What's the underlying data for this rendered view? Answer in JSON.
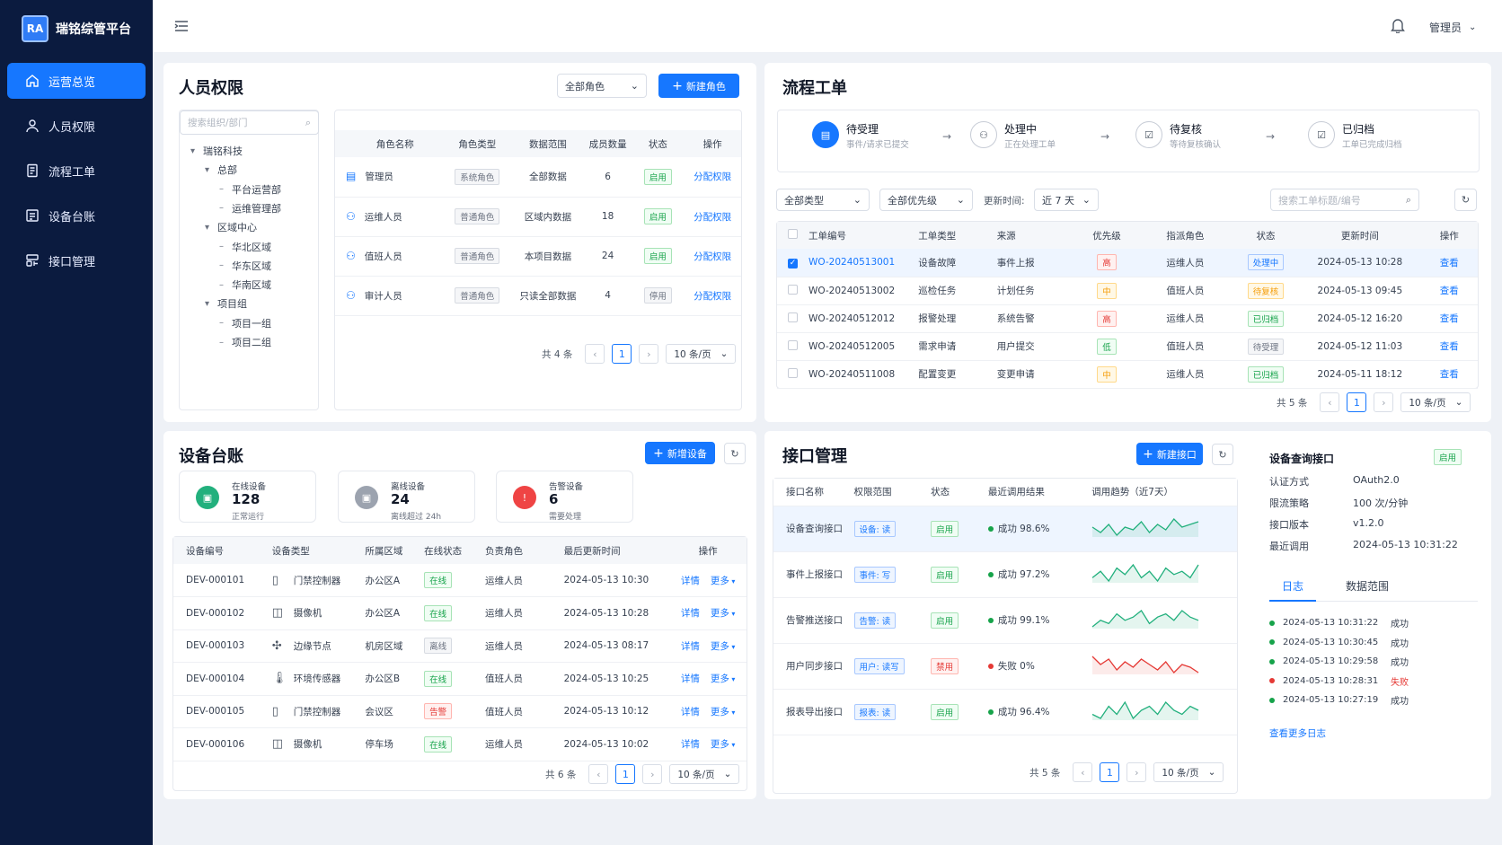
{
  "brand": {
    "logo_text": "RA",
    "name": "瑞铭综管平台"
  },
  "sidebar": {
    "items": [
      {
        "label": "运营总览",
        "icon": "home-icon"
      },
      {
        "label": "人员权限",
        "icon": "user-icon"
      },
      {
        "label": "流程工单",
        "icon": "document-icon"
      },
      {
        "label": "设备台账",
        "icon": "ledger-icon"
      },
      {
        "label": "接口管理",
        "icon": "api-icon"
      }
    ]
  },
  "topbar": {
    "user": "管理员"
  },
  "people": {
    "title": "人员权限",
    "role_filter": "全部角色",
    "new_role_label": "新建角色",
    "search_placeholder": "搜索组织/部门",
    "tree": [
      {
        "label": "瑞铭科技",
        "level": 0
      },
      {
        "label": "总部",
        "level": 1
      },
      {
        "label": "平台运营部",
        "level": 2
      },
      {
        "label": "运维管理部",
        "level": 2
      },
      {
        "label": "区域中心",
        "level": 1
      },
      {
        "label": "华北区域",
        "level": 2
      },
      {
        "label": "华东区域",
        "level": 2
      },
      {
        "label": "华南区域",
        "level": 2
      },
      {
        "label": "项目组",
        "level": 1
      },
      {
        "label": "项目一组",
        "level": 2
      },
      {
        "label": "项目二组",
        "level": 2
      }
    ],
    "columns": [
      "角色名称",
      "角色类型",
      "数据范围",
      "成员数量",
      "状态",
      "操作"
    ],
    "rows": [
      {
        "name": "管理员",
        "type": "系统角色",
        "scope": "全部数据",
        "count": "6",
        "status": "启用",
        "action": "分配权限"
      },
      {
        "name": "运维人员",
        "type": "普通角色",
        "scope": "区域内数据",
        "count": "18",
        "status": "启用",
        "action": "分配权限"
      },
      {
        "name": "值班人员",
        "type": "普通角色",
        "scope": "本项目数据",
        "count": "24",
        "status": "启用",
        "action": "分配权限"
      },
      {
        "name": "审计人员",
        "type": "普通角色",
        "scope": "只读全部数据",
        "count": "4",
        "status": "停用",
        "action": "分配权限"
      }
    ],
    "total": "共 4 条",
    "page": "1",
    "page_size": "10 条/页"
  },
  "workflow": {
    "title": "流程工单",
    "steps": [
      {
        "title": "待受理",
        "desc": "事件/请求已提交"
      },
      {
        "title": "处理中",
        "desc": "正在处理工单"
      },
      {
        "title": "待复核",
        "desc": "等待复核确认"
      },
      {
        "title": "已归档",
        "desc": "工单已完成归档"
      }
    ],
    "type_filter": "全部类型",
    "priority_filter": "全部优先级",
    "time_label": "更新时间:",
    "time_filter": "近 7 天",
    "search_placeholder": "搜索工单标题/编号",
    "columns": [
      "工单编号",
      "工单类型",
      "来源",
      "优先级",
      "指派角色",
      "状态",
      "更新时间",
      "操作"
    ],
    "rows": [
      {
        "id": "WO-20240513001",
        "type": "设备故障",
        "source": "事件上报",
        "priority": "高",
        "role": "运维人员",
        "status": "处理中",
        "time": "2024-05-13 10:28",
        "action": "查看"
      },
      {
        "id": "WO-20240513002",
        "type": "巡检任务",
        "source": "计划任务",
        "priority": "中",
        "role": "值班人员",
        "status": "待复核",
        "time": "2024-05-13 09:45",
        "action": "查看"
      },
      {
        "id": "WO-20240512012",
        "type": "报警处理",
        "source": "系统告警",
        "priority": "高",
        "role": "运维人员",
        "status": "已归档",
        "time": "2024-05-12 16:20",
        "action": "查看"
      },
      {
        "id": "WO-20240512005",
        "type": "需求申请",
        "source": "用户提交",
        "priority": "低",
        "role": "值班人员",
        "status": "待受理",
        "time": "2024-05-12 11:03",
        "action": "查看"
      },
      {
        "id": "WO-20240511008",
        "type": "配置变更",
        "source": "变更申请",
        "priority": "中",
        "role": "运维人员",
        "status": "已归档",
        "time": "2024-05-11 18:12",
        "action": "查看"
      }
    ],
    "total": "共 5 条",
    "page": "1",
    "page_size": "10 条/页"
  },
  "devices": {
    "title": "设备台账",
    "add_label": "新增设备",
    "stats": [
      {
        "label": "在线设备",
        "value": "128",
        "sub": "正常运行",
        "color": "#22b07d"
      },
      {
        "label": "离线设备",
        "value": "24",
        "sub": "离线超过 24h",
        "color": "#9ca3af"
      },
      {
        "label": "告警设备",
        "value": "6",
        "sub": "需要处理",
        "color": "#ef4444"
      }
    ],
    "columns": [
      "设备编号",
      "设备类型",
      "所属区域",
      "在线状态",
      "负责角色",
      "最后更新时间",
      "操作"
    ],
    "rows": [
      {
        "id": "DEV-000101",
        "type": "门禁控制器",
        "icon": "door-icon",
        "area": "办公区A",
        "status": "在线",
        "role": "运维人员",
        "time": "2024-05-13 10:30",
        "detail": "详情",
        "more": "更多"
      },
      {
        "id": "DEV-000102",
        "type": "摄像机",
        "icon": "camera-icon",
        "area": "办公区A",
        "status": "在线",
        "role": "运维人员",
        "time": "2024-05-13 10:28",
        "detail": "详情",
        "more": "更多"
      },
      {
        "id": "DEV-000103",
        "type": "边缘节点",
        "icon": "node-icon",
        "area": "机房区域",
        "status": "离线",
        "role": "运维人员",
        "time": "2024-05-13 08:17",
        "detail": "详情",
        "more": "更多"
      },
      {
        "id": "DEV-000104",
        "type": "环境传感器",
        "icon": "thermometer-icon",
        "area": "办公区B",
        "status": "在线",
        "role": "值班人员",
        "time": "2024-05-13 10:25",
        "detail": "详情",
        "more": "更多"
      },
      {
        "id": "DEV-000105",
        "type": "门禁控制器",
        "icon": "door-icon",
        "area": "会议区",
        "status": "告警",
        "role": "值班人员",
        "time": "2024-05-13 10:12",
        "detail": "详情",
        "more": "更多"
      },
      {
        "id": "DEV-000106",
        "type": "摄像机",
        "icon": "camera-icon",
        "area": "停车场",
        "status": "在线",
        "role": "运维人员",
        "time": "2024-05-13 10:02",
        "detail": "详情",
        "more": "更多"
      }
    ],
    "total": "共 6 条",
    "page": "1",
    "page_size": "10 条/页"
  },
  "apis": {
    "title": "接口管理",
    "new_label": "新建接口",
    "columns": [
      "接口名称",
      "权限范围",
      "状态",
      "最近调用结果",
      "调用趋势（近7天）"
    ],
    "rows": [
      {
        "name": "设备查询接口",
        "scope": "设备: 读",
        "status": "启用",
        "result": "成功 98.6%",
        "ok": true,
        "trend": [
          5,
          3,
          6,
          2,
          5,
          4,
          7,
          3,
          6,
          4,
          8,
          5,
          6,
          7
        ]
      },
      {
        "name": "事件上报接口",
        "scope": "事件: 写",
        "status": "启用",
        "result": "成功 97.2%",
        "ok": true,
        "trend": [
          4,
          6,
          3,
          7,
          5,
          8,
          4,
          6,
          3,
          7,
          5,
          6,
          4,
          8
        ]
      },
      {
        "name": "告警推送接口",
        "scope": "告警: 读",
        "status": "启用",
        "result": "成功 99.1%",
        "ok": true,
        "trend": [
          3,
          5,
          4,
          7,
          5,
          6,
          8,
          4,
          6,
          7,
          5,
          8,
          6,
          5
        ]
      },
      {
        "name": "用户同步接口",
        "scope": "用户: 读写",
        "status": "禁用",
        "result": "失败 0%",
        "ok": false,
        "trend": [
          8,
          5,
          7,
          3,
          6,
          4,
          7,
          5,
          3,
          6,
          2,
          5,
          4,
          2
        ]
      },
      {
        "name": "报表导出接口",
        "scope": "报表: 读",
        "status": "启用",
        "result": "成功 96.4%",
        "ok": true,
        "trend": [
          4,
          3,
          6,
          4,
          7,
          3,
          5,
          6,
          4,
          7,
          5,
          4,
          6,
          5
        ]
      }
    ],
    "total": "共 5 条",
    "page": "1",
    "page_size": "10 条/页",
    "detail": {
      "title": "设备查询接口",
      "status": "启用",
      "fields": [
        {
          "k": "认证方式",
          "v": "OAuth2.0"
        },
        {
          "k": "限流策略",
          "v": "100 次/分钟"
        },
        {
          "k": "接口版本",
          "v": "v1.2.0"
        },
        {
          "k": "最近调用",
          "v": "2024-05-13 10:31:22"
        }
      ],
      "tabs": [
        "日志",
        "数据范围"
      ],
      "logs": [
        {
          "time": "2024-05-13 10:31:22",
          "result": "成功",
          "ok": true
        },
        {
          "time": "2024-05-13 10:30:45",
          "result": "成功",
          "ok": true
        },
        {
          "time": "2024-05-13 10:29:58",
          "result": "成功",
          "ok": true
        },
        {
          "time": "2024-05-13 10:28:31",
          "result": "失败",
          "ok": false
        },
        {
          "time": "2024-05-13 10:27:19",
          "result": "成功",
          "ok": true
        }
      ],
      "more_logs": "查看更多日志"
    }
  }
}
